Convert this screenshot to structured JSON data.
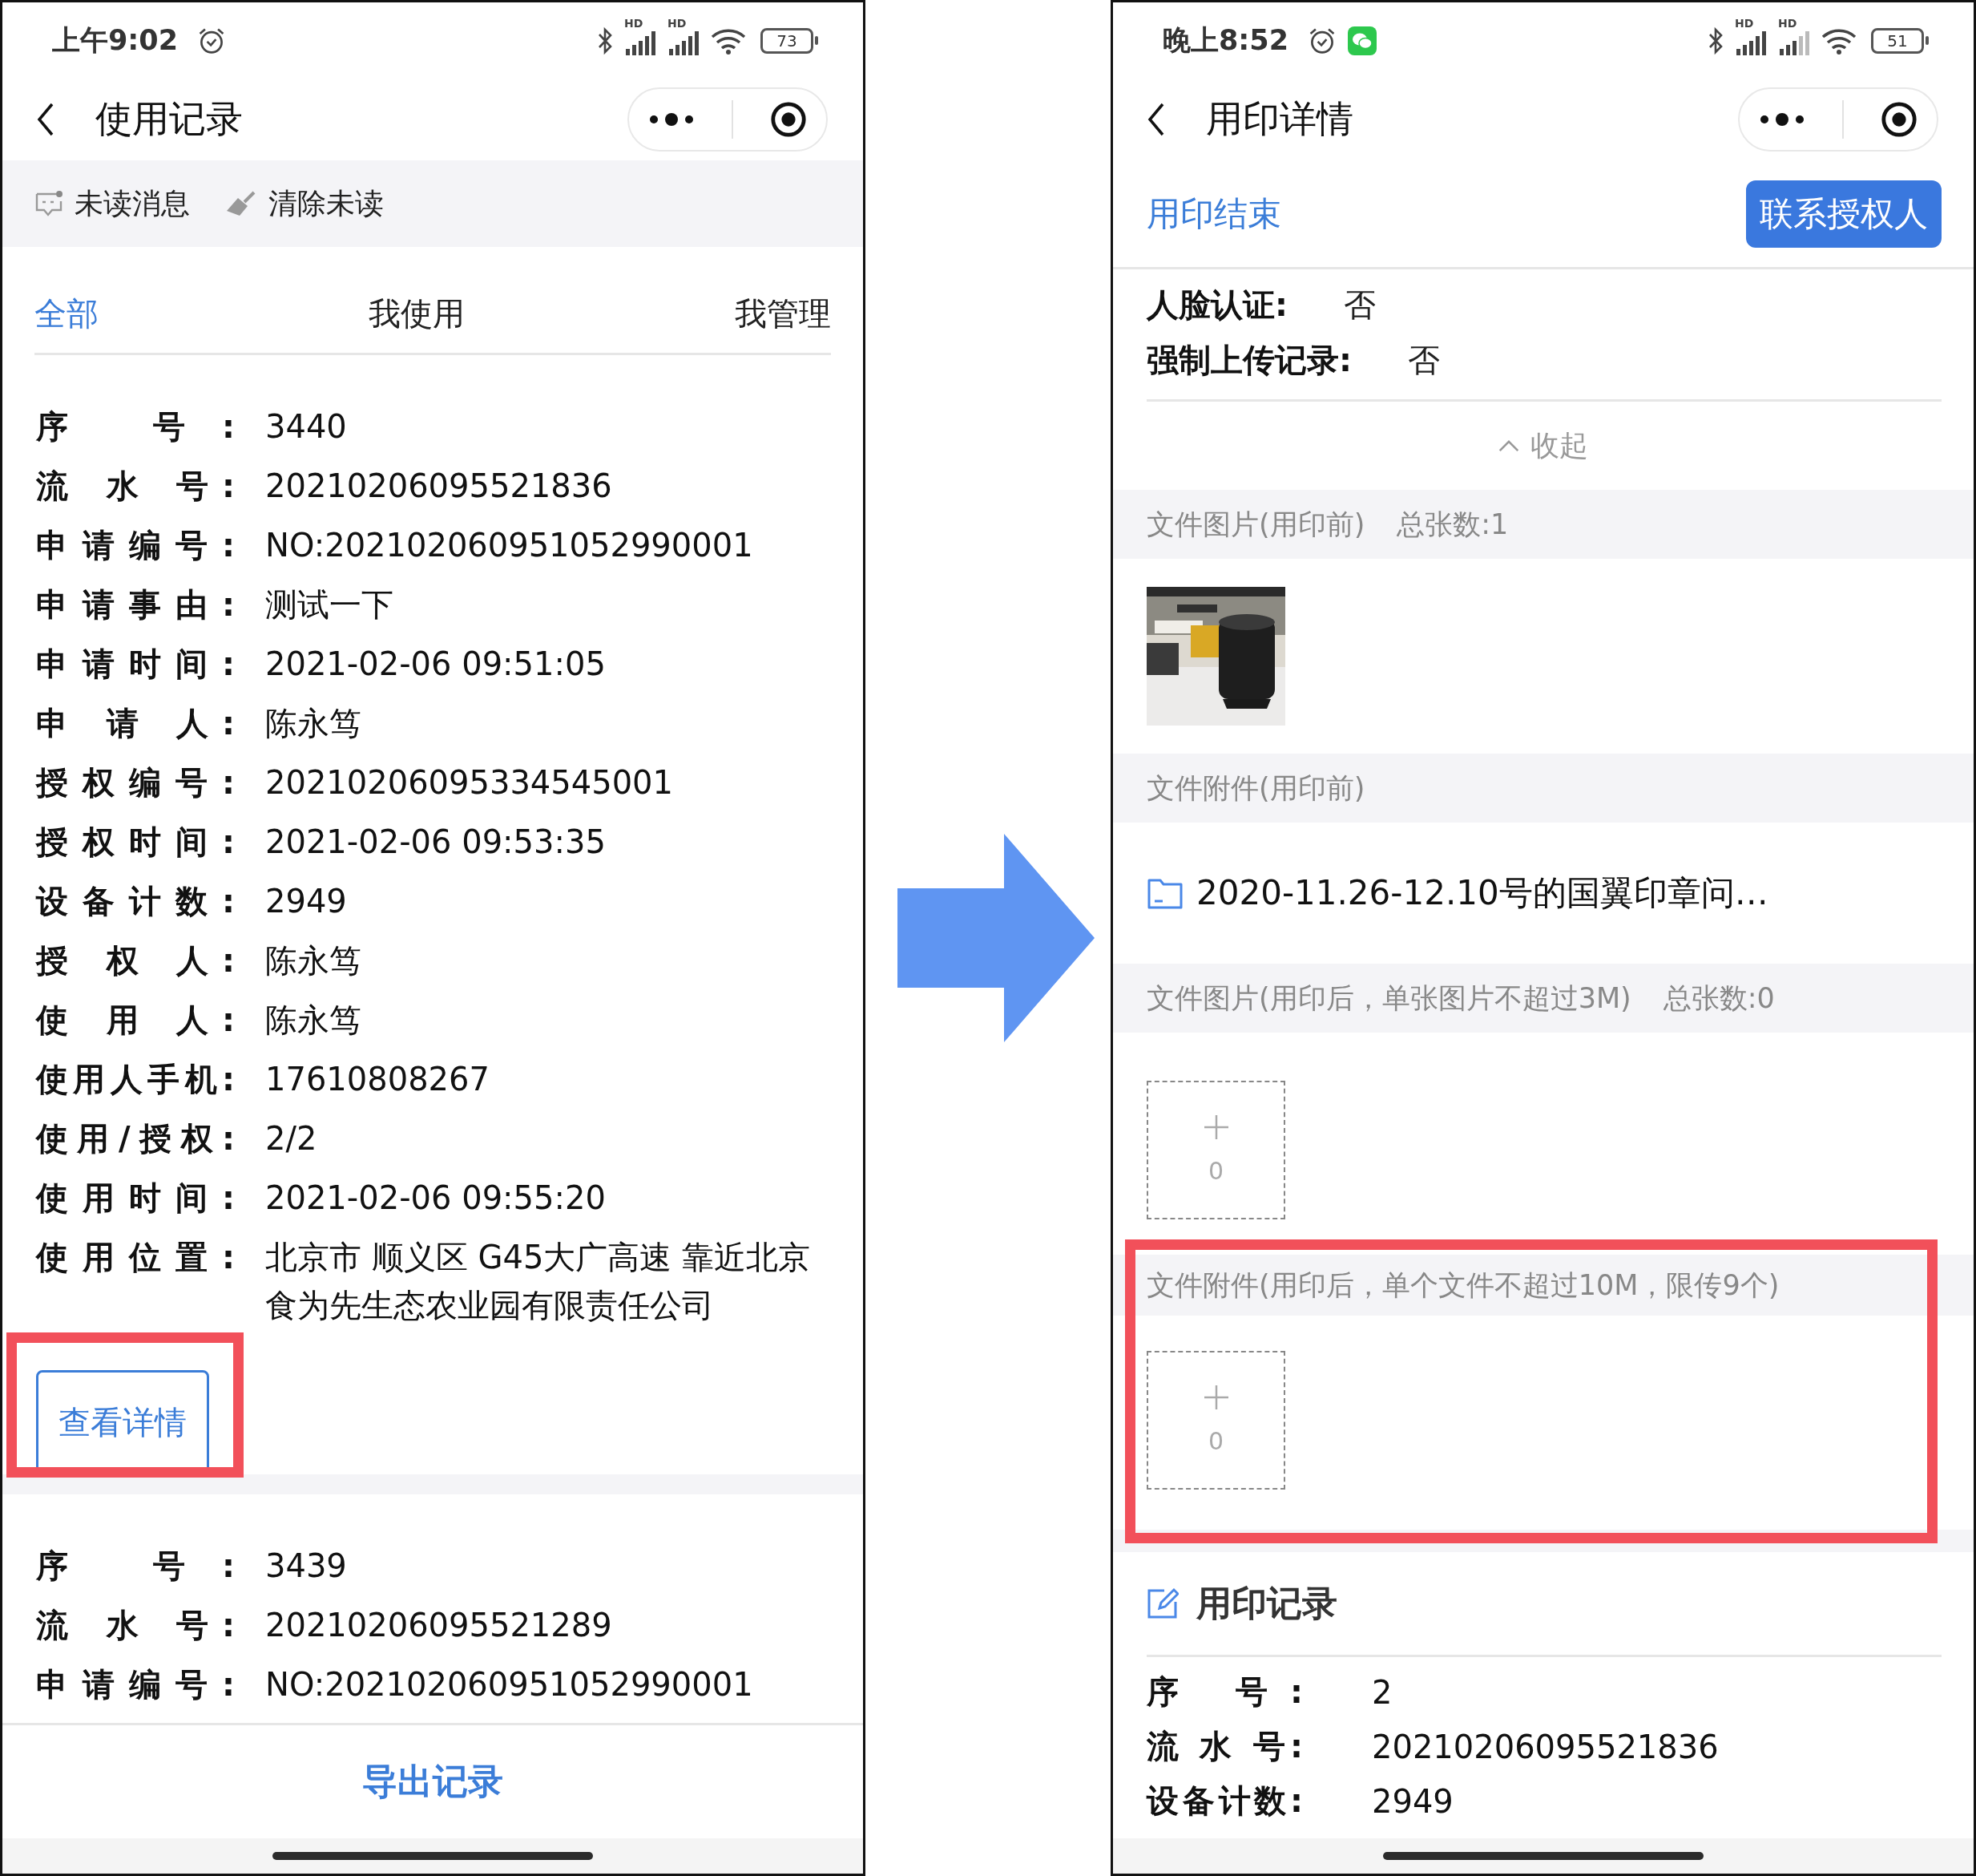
{
  "left_screen": {
    "status_bar": {
      "time": "上午9:02",
      "signals": [
        "HD",
        "HD"
      ],
      "battery": "73"
    },
    "nav_bar": {
      "title": "使用记录"
    },
    "toolbar": [
      {
        "kind": "message",
        "label": "未读消息"
      },
      {
        "kind": "broom",
        "label": "清除未读"
      }
    ],
    "tabs": [
      {
        "label": "全部",
        "selected": true
      },
      {
        "label": "我使用",
        "selected": false
      },
      {
        "label": "我管理",
        "selected": false
      }
    ],
    "records": [
      {
        "fields": [
          {
            "label": "序 号:",
            "value": "3440"
          },
          {
            "label": "流 水 号:",
            "value": "20210206095521836"
          },
          {
            "label": "申请编号:",
            "value": "NO:202102060951052990001"
          },
          {
            "label": "申请事由:",
            "value": "测试一下"
          },
          {
            "label": "申请时间:",
            "value": "2021-02-06 09:51:05"
          },
          {
            "label": "申 请 人:",
            "value": "陈永笃"
          },
          {
            "label": "授权编号:",
            "value": "20210206095334545001"
          },
          {
            "label": "授权时间:",
            "value": "2021-02-06 09:53:35"
          },
          {
            "label": "设备计数:",
            "value": "2949"
          },
          {
            "label": "授 权 人:",
            "value": "陈永笃"
          },
          {
            "label": "使 用 人:",
            "value": "陈永笃"
          },
          {
            "label": "使用人手机:",
            "value": "17610808267"
          },
          {
            "label": "使用/授权:",
            "value": "2/2"
          },
          {
            "label": "使用时间:",
            "value": "2021-02-06 09:55:20"
          },
          {
            "label": "使用位置:",
            "value": "北京市 顺义区 G45大广高速 靠近北京食为先生态农业园有限责任公司"
          }
        ],
        "details_button": {
          "label": "查看详情",
          "highlighted": true
        }
      },
      {
        "fields": [
          {
            "label": "序 号:",
            "value": "3439"
          },
          {
            "label": "流 水 号:",
            "value": "20210206095521289"
          },
          {
            "label": "申请编号:",
            "value": "NO:202102060951052990001"
          }
        ]
      }
    ],
    "footer_button": "导出记录"
  },
  "right_screen": {
    "status_bar": {
      "time": "晚上8:52",
      "signals": [
        "HD",
        "HD"
      ],
      "battery": "51"
    },
    "nav_bar": {
      "title": "用印详情"
    },
    "actions": {
      "end_link": "用印结束",
      "contact_button": "联系授权人"
    },
    "settings": [
      {
        "label": "人脸认证:",
        "value": "否"
      },
      {
        "label": "强制上传记录:",
        "value": "否"
      }
    ],
    "collapse": "收起",
    "sections": [
      {
        "kind": "images",
        "title": "文件图片(用印前)",
        "count": "总张数:1",
        "highlighted": false
      },
      {
        "kind": "files",
        "title": "文件附件(用印前)",
        "files": [
          "2020-11.26-12.10号的国翼印章问…"
        ],
        "highlighted": false
      },
      {
        "kind": "upload",
        "title": "文件图片(用印后，单张图片不超过3M)",
        "count": "总张数:0",
        "upload_count": "0",
        "highlighted": false
      },
      {
        "kind": "upload",
        "title": "文件附件(用印后，单个文件不超过10M，限传9个)",
        "upload_count": "0",
        "highlighted": true
      }
    ],
    "record_section": {
      "title": "用印记录",
      "fields": [
        {
          "label": "序 号:",
          "value": "2"
        },
        {
          "label": "流 水 号:",
          "value": "20210206095521836"
        },
        {
          "label": "设备计数:",
          "value": "2949"
        }
      ]
    }
  }
}
